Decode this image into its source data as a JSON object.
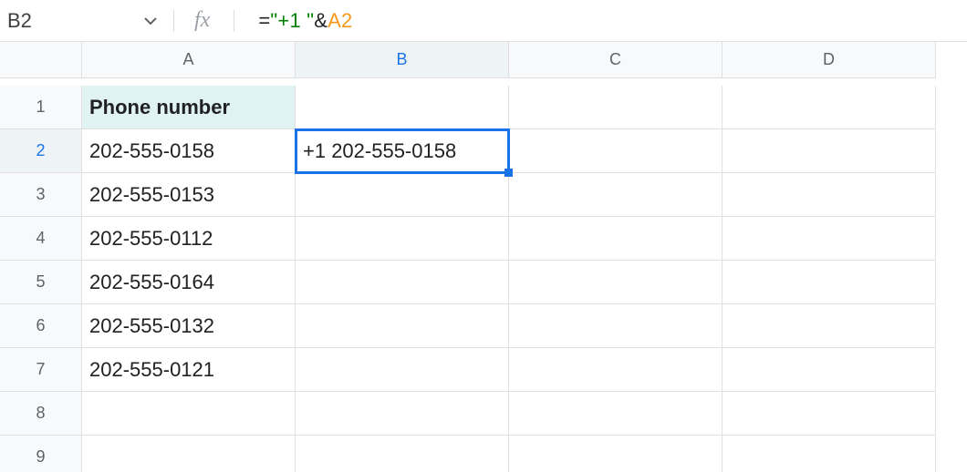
{
  "namebox": {
    "value": "B2"
  },
  "formula": {
    "equals": "=",
    "string": "\"+1  \"",
    "operator": "&",
    "ref": "A2"
  },
  "columns": [
    "A",
    "B",
    "C",
    "D"
  ],
  "rows": [
    "1",
    "2",
    "3",
    "4",
    "5",
    "6",
    "7",
    "8",
    "9"
  ],
  "selection": {
    "row": "2",
    "col": "B"
  },
  "cells": {
    "A1": "Phone number",
    "A2": "202-555-0158",
    "A3": "202-555-0153",
    "A4": "202-555-0112",
    "A5": "202-555-0164",
    "A6": "202-555-0132",
    "A7": "202-555-0121",
    "B2": "+1 202-555-0158"
  }
}
